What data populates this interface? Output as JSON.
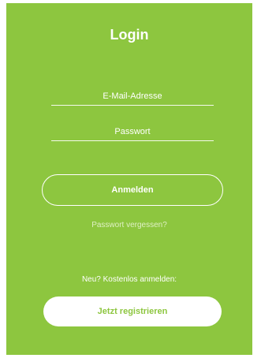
{
  "colors": {
    "background": "#8dc63f",
    "text": "#ffffff",
    "link": "#dff0c4"
  },
  "login": {
    "title": "Login",
    "email_placeholder": "E-Mail-Adresse",
    "email_value": "",
    "password_placeholder": "Passwort",
    "password_value": "",
    "submit_label": "Anmelden",
    "forgot_label": "Passwort vergessen?"
  },
  "register": {
    "prompt": "Neu? Kostenlos anmelden:",
    "button_label": "Jetzt registrieren"
  }
}
